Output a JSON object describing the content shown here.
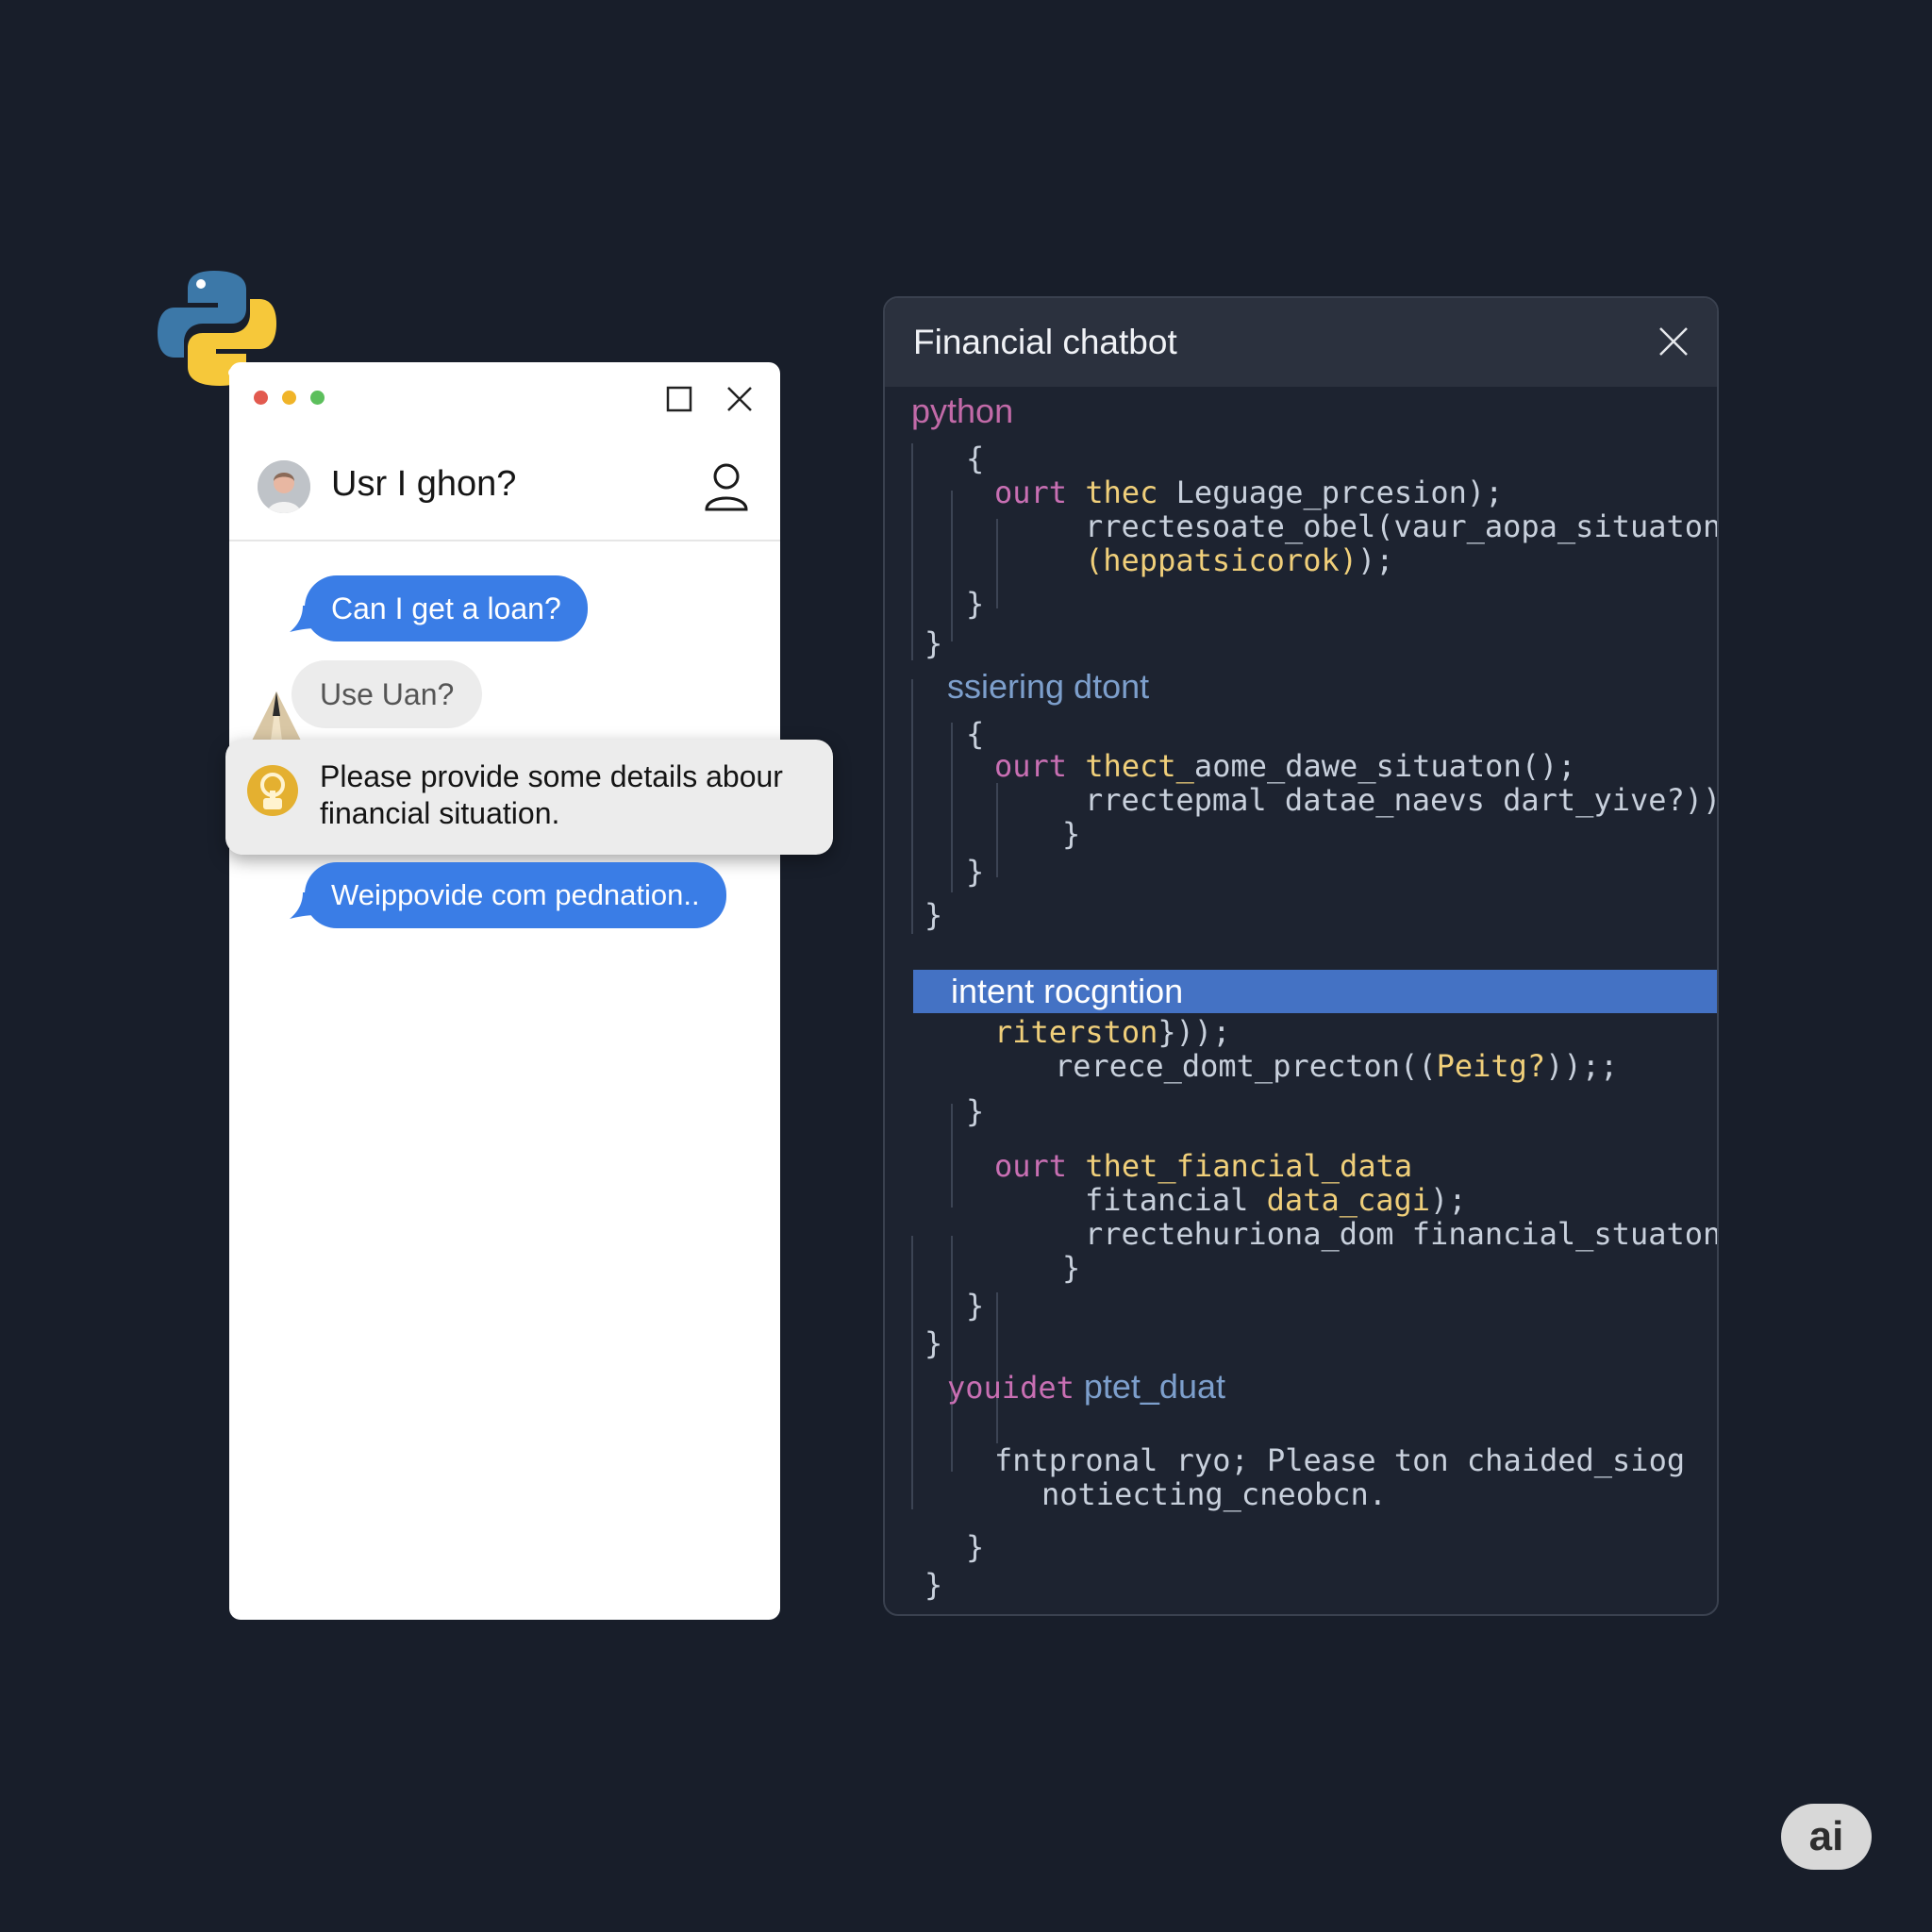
{
  "chat": {
    "title_user": "Usr I ghon?",
    "messages": [
      {
        "from": "user",
        "text": "Can I get a loan?"
      },
      {
        "from": "bot",
        "text": "Use Uan?"
      },
      {
        "from": "bot_popup",
        "text": "Please provide some details abour financial situation."
      },
      {
        "from": "user",
        "text": "Weippovide com pednation.."
      }
    ],
    "dots": [
      "#e25a4f",
      "#f0b429",
      "#5cbf5c"
    ]
  },
  "code_window": {
    "title": "Financial chatbot",
    "lines": [
      {
        "cls": "pyword",
        "text": "python"
      },
      {
        "cls": "tx",
        "text": "{"
      },
      {
        "cls": "kw",
        "text": "ourt",
        "rest_cls": "fn",
        "rest": " thec ",
        "tail_cls": "tx",
        "tail": "Leguage_prcesion);"
      },
      {
        "cls": "tx",
        "text": "rrectesoate_obel(vaur_aopa_situaton);"
      },
      {
        "cls": "fn",
        "text": "(heppatsicorok)",
        "tail_cls": "tx",
        "tail": ");"
      },
      {
        "cls": "tx",
        "text": "}"
      },
      {
        "cls": "tx",
        "text": "}"
      },
      {
        "cls": "sec",
        "text": "ssiering dtont"
      },
      {
        "cls": "tx",
        "text": "{"
      },
      {
        "cls": "kw",
        "text": "ourt",
        "rest_cls": "fn",
        "rest": " thect_",
        "tail_cls": "tx",
        "tail": "aome_dawe_situaton();"
      },
      {
        "cls": "tx",
        "text": "rrectepmal datae_naevs dart_yive?));"
      },
      {
        "cls": "tx",
        "text": "}"
      },
      {
        "cls": "tx",
        "text": "}"
      },
      {
        "cls": "tx",
        "text": "}"
      },
      {
        "cls": "sec",
        "text": "intent rocgntion"
      },
      {
        "cls": "fn",
        "text": "riterston",
        "tail_cls": "tx",
        "tail": "}));"
      },
      {
        "cls": "tx",
        "text": "rerece_domt_precton((",
        "rest_cls": "fn",
        "rest": "Peitg?",
        "tail_cls": "tx",
        "tail": "));;"
      },
      {
        "cls": "tx",
        "text": "}"
      },
      {
        "cls": "kw",
        "text": "ourt",
        "rest_cls": "fn",
        "rest": " thet_fiancial_data",
        "tail_cls": "tx",
        "tail": ""
      },
      {
        "cls": "tx",
        "text": "fitancial ",
        "rest_cls": "fn",
        "rest": "data_cagi",
        "tail_cls": "tx",
        "tail": ");"
      },
      {
        "cls": "tx",
        "text": "rrectehuriona_dom financial_stuaton);"
      },
      {
        "cls": "tx",
        "text": "}"
      },
      {
        "cls": "tx",
        "text": "}"
      },
      {
        "cls": "tx",
        "text": "}"
      },
      {
        "cls": "kw",
        "text": "youidet",
        "rest_cls": "sec",
        "rest": " ptet_duat",
        "tail_cls": "tx",
        "tail": ""
      },
      {
        "cls": "tx",
        "text": "fntpronal ryo; Please ton chaided_siog"
      },
      {
        "cls": "tx",
        "text": "notiecting_cneobcn."
      },
      {
        "cls": "tx",
        "text": "}"
      },
      {
        "cls": "tx",
        "text": "}"
      }
    ]
  },
  "badge": {
    "text": "ai"
  },
  "icons": [
    "python-logo-icon",
    "maximize-icon",
    "close-icon",
    "user-icon",
    "avatar",
    "warning-triangle-icon",
    "bot-icon",
    "close-icon"
  ]
}
